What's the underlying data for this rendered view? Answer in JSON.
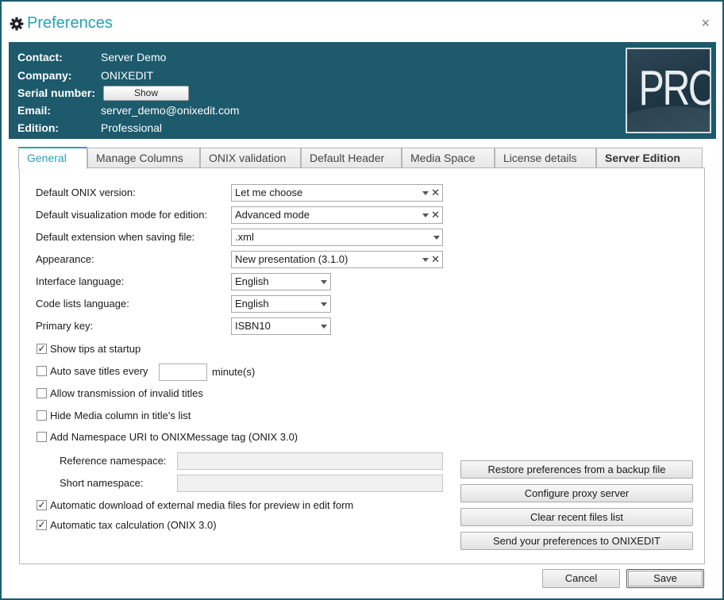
{
  "window": {
    "title": "Preferences",
    "close_glyph": "×"
  },
  "header": {
    "contact_label": "Contact:",
    "contact_value": "Server Demo",
    "company_label": "Company:",
    "company_value": "ONIXEDIT",
    "serial_label": "Serial number:",
    "serial_button": "Show",
    "email_label": "Email:",
    "email_value": "server_demo@onixedit.com",
    "edition_label": "Edition:",
    "edition_value": "Professional",
    "badge_text": "PRO"
  },
  "tabs": [
    "General",
    "Manage Columns",
    "ONIX validation",
    "Default Header",
    "Media Space",
    "License details",
    "Server Edition"
  ],
  "active_tab": "General",
  "general": {
    "onix_version": {
      "label": "Default ONIX version:",
      "value": "Let me choose"
    },
    "visualization": {
      "label": "Default visualization mode for edition:",
      "value": "Advanced mode"
    },
    "extension": {
      "label": "Default extension when saving file:",
      "value": ".xml"
    },
    "appearance": {
      "label": "Appearance:",
      "value": "New presentation (3.1.0)"
    },
    "interface_language": {
      "label": "Interface language:",
      "value": "English"
    },
    "codelist_language": {
      "label": "Code lists language:",
      "value": "English"
    },
    "primary_key": {
      "label": "Primary key:",
      "value": "ISBN10"
    },
    "show_tips": {
      "label": "Show tips at startup",
      "checked": true
    },
    "auto_save": {
      "label": "Auto save titles every",
      "suffix": "minute(s)",
      "value": "",
      "checked": false
    },
    "allow_invalid": {
      "label": "Allow transmission of invalid titles",
      "checked": false
    },
    "hide_media": {
      "label": "Hide Media column in title's list",
      "checked": false
    },
    "add_namespace": {
      "label": "Add Namespace URI to ONIXMessage tag (ONIX 3.0)",
      "checked": false
    },
    "reference_namespace": {
      "label": "Reference namespace:",
      "value": ""
    },
    "short_namespace": {
      "label": "Short namespace:",
      "value": ""
    },
    "auto_download": {
      "label": "Automatic download of external media files for preview in edit form",
      "checked": true
    },
    "auto_tax": {
      "label": "Automatic tax calculation (ONIX 3.0)",
      "checked": true
    },
    "check_glyph": "✓",
    "clear_glyph": "✕"
  },
  "actions": {
    "restore": "Restore preferences from a backup file",
    "proxy": "Configure proxy server",
    "clear_recent": "Clear recent files list",
    "send": "Send your preferences to ONIXEDIT"
  },
  "footer": {
    "cancel": "Cancel",
    "save": "Save"
  },
  "colors": {
    "accent": "#2aa0b8",
    "header_bg": "#1c5a6c",
    "frame": "#1d5a6e"
  }
}
